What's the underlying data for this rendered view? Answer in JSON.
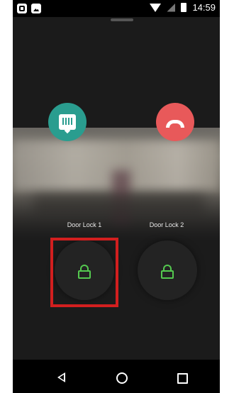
{
  "status_bar": {
    "time": "14:59",
    "icons": [
      "app-notification-icon",
      "image-notification-icon",
      "wifi-icon",
      "no-signal-icon",
      "battery-icon"
    ]
  },
  "call": {
    "answer_icon": "intercom-icon",
    "hangup_icon": "hangup-phone-icon",
    "colors": {
      "answer": "#2a9d8f",
      "hangup": "#e8595a",
      "lock_accent": "#54c94f"
    }
  },
  "locks": [
    {
      "label": "Door Lock 1",
      "icon": "padlock-icon"
    },
    {
      "label": "Door Lock 2",
      "icon": "padlock-icon"
    }
  ],
  "navigation": {
    "icons": [
      "back-icon",
      "home-icon",
      "recent-apps-icon"
    ]
  },
  "highlight_color": "#d21f1f"
}
